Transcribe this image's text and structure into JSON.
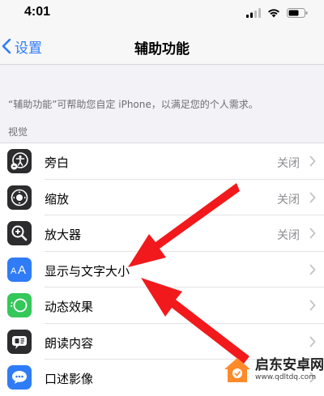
{
  "status_bar": {
    "time": "4:01"
  },
  "nav": {
    "back_label": "设置",
    "title": "辅助功能"
  },
  "description": "“辅助功能”可帮助您自定 iPhone，以满足您的个人需求。",
  "section_header": "视觉",
  "rows": [
    {
      "label": "旁白",
      "value": "关闭",
      "icon": "voiceover-icon",
      "icon_color": "#2c2c2e"
    },
    {
      "label": "缩放",
      "value": "关闭",
      "icon": "zoom-icon",
      "icon_color": "#2c2c2e"
    },
    {
      "label": "放大器",
      "value": "关闭",
      "icon": "magnifier-icon",
      "icon_color": "#2c2c2e"
    },
    {
      "label": "显示与文字大小",
      "value": "",
      "icon": "text-size-icon",
      "icon_color": "#2f7cf6"
    },
    {
      "label": "动态效果",
      "value": "",
      "icon": "motion-icon",
      "icon_color": "#34c759"
    },
    {
      "label": "朗读内容",
      "value": "",
      "icon": "spoken-content-icon",
      "icon_color": "#2c2c2e"
    },
    {
      "label": "口述影像",
      "value": "",
      "icon": "audio-description-icon",
      "icon_color": "#2f7cf6"
    }
  ],
  "watermark": {
    "title": "启东安卓网",
    "url": "www.qdltdq.com",
    "logo": "house-logo-icon"
  },
  "colors": {
    "accent": "#2f7cf6",
    "annotation_arrow": "#f2191c"
  }
}
